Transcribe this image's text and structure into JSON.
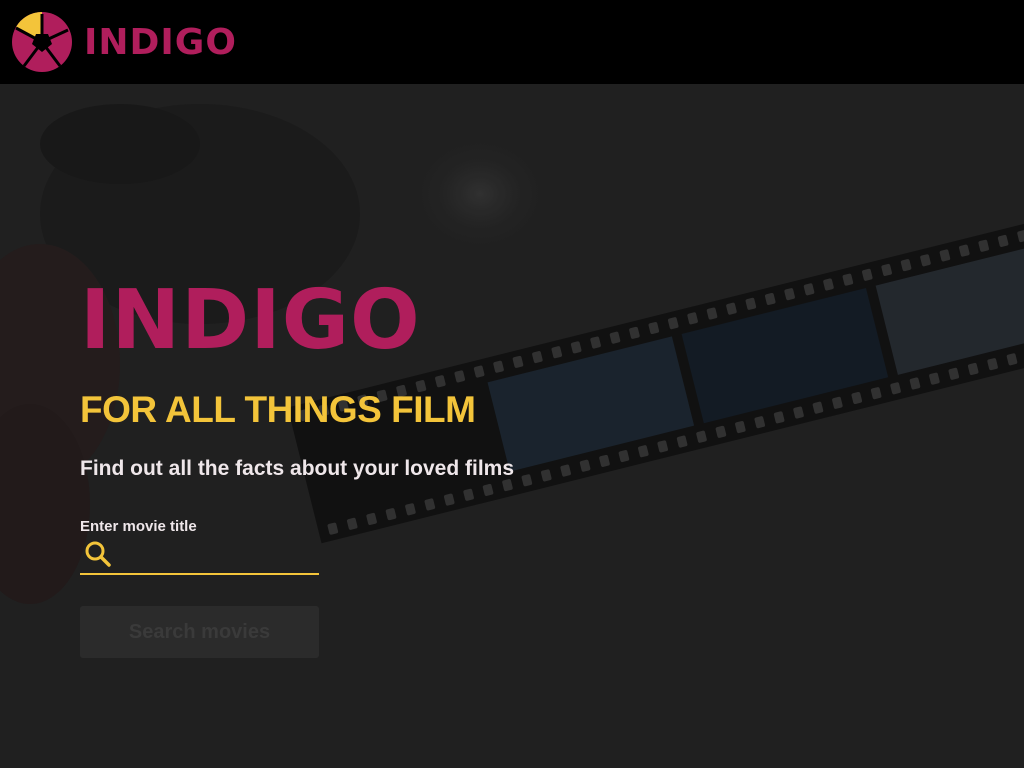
{
  "navbar": {
    "brand_name": "INDIGO",
    "logo_icon": "aperture-logo-icon"
  },
  "hero": {
    "title": "INDIGO",
    "tagline": "FOR ALL THINGS FILM",
    "subtitle": "Find out all the facts about your loved films",
    "search": {
      "label": "Enter movie title",
      "value": "",
      "placeholder": "",
      "icon": "search-icon"
    },
    "button_label": "Search movies",
    "button_state": "disabled",
    "background": "film-strip-photo"
  },
  "colors": {
    "brand": "#b01e5c",
    "accent": "#f3c43a",
    "navbar_bg": "#000000",
    "hero_overlay": "#262626",
    "text_light": "#efe7ea"
  }
}
